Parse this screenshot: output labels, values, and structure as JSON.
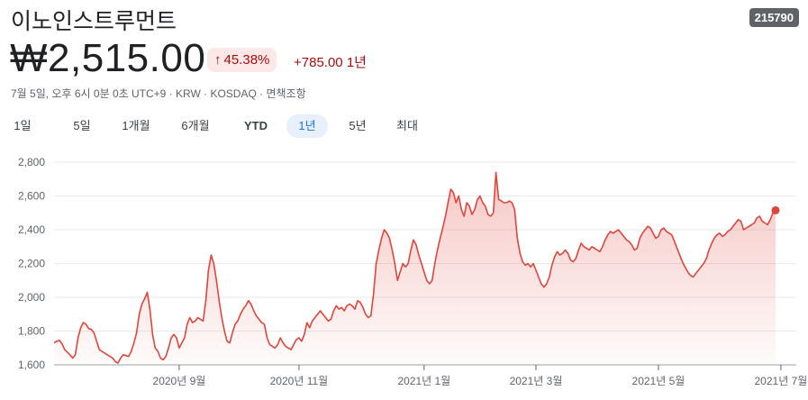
{
  "header": {
    "title": "이노인스트루먼트",
    "ticker": "215790",
    "price": "₩2,515.00",
    "change_percent": "45.38%",
    "change_abs": "+785.00",
    "period": "1년",
    "meta": "7월 5일, 오후 6시 0분 0초 UTC+9 · KRW · KOSDAQ · 면책조항"
  },
  "tabs": [
    "1일",
    "5일",
    "1개월",
    "6개월",
    "YTD",
    "1년",
    "5년",
    "최대"
  ],
  "active_tab": "1년",
  "colors": {
    "line": "#e0453b",
    "fill": "#f4c7c3",
    "grid": "#e8eaed",
    "negative": "#a50e0e"
  },
  "chart_data": {
    "type": "area",
    "y_ticks": [
      1600,
      1800,
      2000,
      2200,
      2400,
      2600,
      2800
    ],
    "ylim": [
      1600,
      2800
    ],
    "y_tick_labels": [
      "1,600",
      "1,800",
      "2,000",
      "2,200",
      "2,400",
      "2,600",
      "2,800"
    ],
    "x_ticks": [
      {
        "label": "2020년 9월",
        "index": 47
      },
      {
        "label": "2020년 11월",
        "index": 92
      },
      {
        "label": "2021년 1월",
        "index": 139
      },
      {
        "label": "2021년 3월",
        "index": 181
      },
      {
        "label": "2021년 5월",
        "index": 227
      },
      {
        "label": "2021년 7월",
        "index": 273
      }
    ],
    "values": [
      1730,
      1740,
      1745,
      1725,
      1690,
      1675,
      1660,
      1640,
      1660,
      1760,
      1820,
      1850,
      1840,
      1815,
      1810,
      1790,
      1740,
      1690,
      1680,
      1670,
      1660,
      1650,
      1640,
      1620,
      1610,
      1640,
      1660,
      1655,
      1650,
      1680,
      1730,
      1790,
      1900,
      1960,
      1990,
      2030,
      1930,
      1780,
      1700,
      1680,
      1640,
      1630,
      1650,
      1700,
      1760,
      1780,
      1760,
      1700,
      1730,
      1760,
      1840,
      1880,
      1850,
      1860,
      1880,
      1870,
      1860,
      1980,
      2160,
      2250,
      2200,
      2100,
      1980,
      1880,
      1800,
      1740,
      1730,
      1790,
      1840,
      1860,
      1900,
      1930,
      1950,
      1980,
      1960,
      1920,
      1890,
      1870,
      1850,
      1840,
      1760,
      1720,
      1710,
      1700,
      1720,
      1760,
      1730,
      1710,
      1700,
      1690,
      1720,
      1750,
      1760,
      1740,
      1780,
      1850,
      1820,
      1860,
      1880,
      1900,
      1920,
      1900,
      1880,
      1860,
      1870,
      1920,
      1950,
      1930,
      1940,
      1920,
      1950,
      1960,
      1950,
      1930,
      1980,
      1970,
      1940,
      1900,
      1880,
      1890,
      2020,
      2200,
      2280,
      2350,
      2400,
      2380,
      2350,
      2280,
      2200,
      2100,
      2150,
      2200,
      2180,
      2200,
      2280,
      2340,
      2310,
      2250,
      2200,
      2150,
      2100,
      2080,
      2100,
      2200,
      2280,
      2350,
      2410,
      2480,
      2560,
      2640,
      2620,
      2560,
      2600,
      2520,
      2480,
      2560,
      2540,
      2490,
      2520,
      2580,
      2600,
      2560,
      2540,
      2490,
      2480,
      2500,
      2740,
      2580,
      2570,
      2560,
      2560,
      2570,
      2560,
      2520,
      2350,
      2260,
      2210,
      2190,
      2200,
      2180,
      2200,
      2160,
      2120,
      2080,
      2060,
      2080,
      2120,
      2190,
      2240,
      2270,
      2250,
      2260,
      2280,
      2260,
      2220,
      2210,
      2230,
      2280,
      2320,
      2300,
      2290,
      2280,
      2300,
      2290,
      2280,
      2270,
      2300,
      2340,
      2370,
      2390,
      2380,
      2390,
      2400,
      2380,
      2360,
      2340,
      2330,
      2310,
      2280,
      2290,
      2350,
      2380,
      2400,
      2420,
      2410,
      2380,
      2350,
      2360,
      2400,
      2410,
      2390,
      2380,
      2370,
      2330,
      2290,
      2250,
      2210,
      2180,
      2150,
      2130,
      2120,
      2140,
      2160,
      2180,
      2200,
      2230,
      2280,
      2320,
      2350,
      2370,
      2380,
      2360,
      2370,
      2390,
      2400,
      2420,
      2440,
      2460,
      2450,
      2400,
      2410,
      2420,
      2430,
      2440,
      2470,
      2480,
      2450,
      2440,
      2430,
      2460,
      2500,
      2515
    ]
  }
}
